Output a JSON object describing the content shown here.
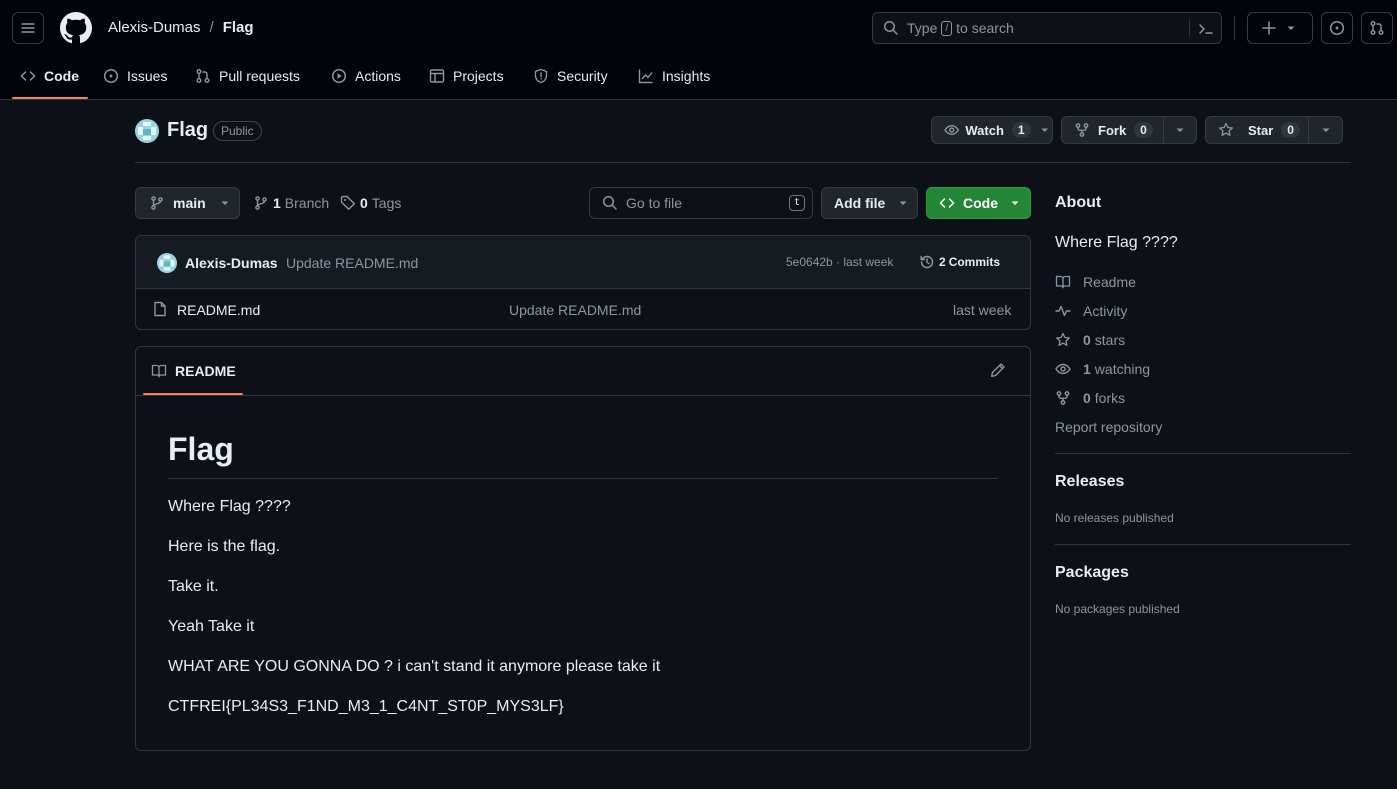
{
  "header": {
    "owner": "Alexis-Dumas",
    "separator": "/",
    "repo": "Flag",
    "search_prefix": "Type",
    "search_key": "/",
    "search_suffix": "to search"
  },
  "nav": {
    "tabs": [
      {
        "label": "Code"
      },
      {
        "label": "Issues"
      },
      {
        "label": "Pull requests"
      },
      {
        "label": "Actions"
      },
      {
        "label": "Projects"
      },
      {
        "label": "Security"
      },
      {
        "label": "Insights"
      }
    ]
  },
  "repo": {
    "name": "Flag",
    "visibility": "Public",
    "watch_label": "Watch",
    "watch_count": "1",
    "fork_label": "Fork",
    "fork_count": "0",
    "star_label": "Star",
    "star_count": "0"
  },
  "toolbar": {
    "branch": "main",
    "branches_count": "1",
    "branches_label": "Branch",
    "tags_count": "0",
    "tags_label": "Tags",
    "goto_placeholder": "Go to file",
    "goto_key": "t",
    "add_file_label": "Add file",
    "code_label": "Code"
  },
  "commit": {
    "author": "Alexis-Dumas",
    "message": "Update README.md",
    "hash_time": "5e0642b · last week",
    "commits_count": "2",
    "commits_label": "Commits"
  },
  "files": [
    {
      "name": "README.md",
      "message": "Update README.md",
      "time": "last week"
    }
  ],
  "readme": {
    "tab_label": "README",
    "heading": "Flag",
    "lines": [
      "Where Flag ????",
      "Here is the flag.",
      "Take it.",
      "Yeah Take it",
      "WHAT ARE YOU GONNA DO ? i can't stand it anymore please take it",
      "CTFREI{PL34S3_F1ND_M3_1_C4NT_ST0P_MYS3LF}"
    ]
  },
  "about": {
    "title": "About",
    "description": "Where Flag ????",
    "readme_label": "Readme",
    "activity_label": "Activity",
    "stars_count": "0",
    "stars_label": "stars",
    "watching_count": "1",
    "watching_label": "watching",
    "forks_count": "0",
    "forks_label": "forks",
    "report_label": "Report repository"
  },
  "releases": {
    "title": "Releases",
    "empty": "No releases published"
  },
  "packages": {
    "title": "Packages",
    "empty": "No packages published"
  },
  "colors": {
    "accent_green": "#238636",
    "tab_underline": "#f78166",
    "background": "#0d1117"
  }
}
